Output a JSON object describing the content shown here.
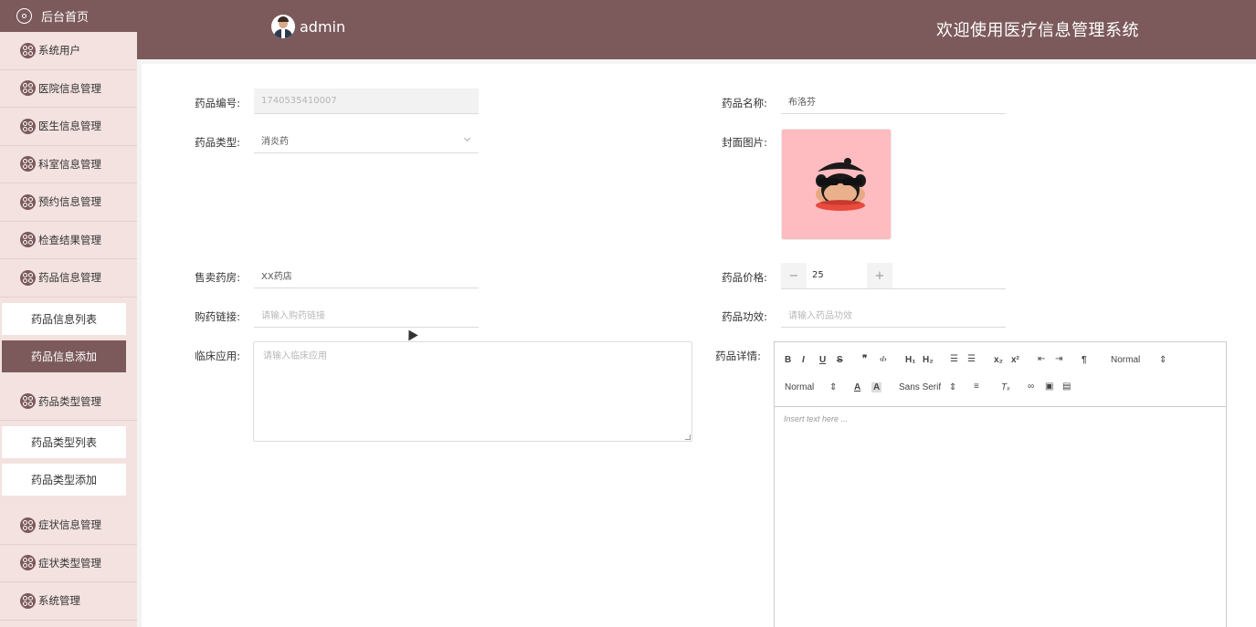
{
  "sidebar": {
    "home": "后台首页",
    "items": [
      {
        "label": "系统用户"
      },
      {
        "label": "医院信息管理"
      },
      {
        "label": "医生信息管理"
      },
      {
        "label": "科室信息管理"
      },
      {
        "label": "预约信息管理"
      },
      {
        "label": "检查结果管理"
      },
      {
        "label": "药品信息管理"
      }
    ],
    "drug_sub": [
      {
        "label": "药品信息列表"
      },
      {
        "label": "药品信息添加"
      }
    ],
    "type_item": "药品类型管理",
    "type_sub": [
      {
        "label": "药品类型列表"
      },
      {
        "label": "药品类型添加"
      }
    ],
    "more_items": [
      {
        "label": "症状信息管理"
      },
      {
        "label": "症状类型管理"
      },
      {
        "label": "系统管理"
      }
    ]
  },
  "header": {
    "username": "admin",
    "title": "欢迎使用医疗信息管理系统"
  },
  "form": {
    "drug_no_label": "药品编号:",
    "drug_no_value": "1740535410007",
    "drug_name_label": "药品名称:",
    "drug_name_value": "布洛芬",
    "drug_type_label": "药品类型:",
    "drug_type_value": "消炎药",
    "cover_label": "封面图片:",
    "pharmacy_label": "售卖药房:",
    "pharmacy_value": "XX药店",
    "price_label": "药品价格:",
    "price_value": "25",
    "price_minus": "−",
    "price_plus": "+",
    "link_label": "购药链接:",
    "link_placeholder": "请输入购药链接",
    "effect_label": "药品功效:",
    "effect_placeholder": "请输入药品功效",
    "clinical_label": "临床应用:",
    "clinical_placeholder": "请输入临床应用",
    "detail_label": "药品详情:"
  },
  "editor": {
    "header_select": "Normal",
    "size_select": "Normal",
    "font_select": "Sans Serif",
    "placeholder": "Insert text here ..."
  },
  "colors": {
    "primary": "#7c5a5b",
    "sidebar_bg": "#f3e2e0",
    "cover_bg": "#ffbcc0"
  }
}
